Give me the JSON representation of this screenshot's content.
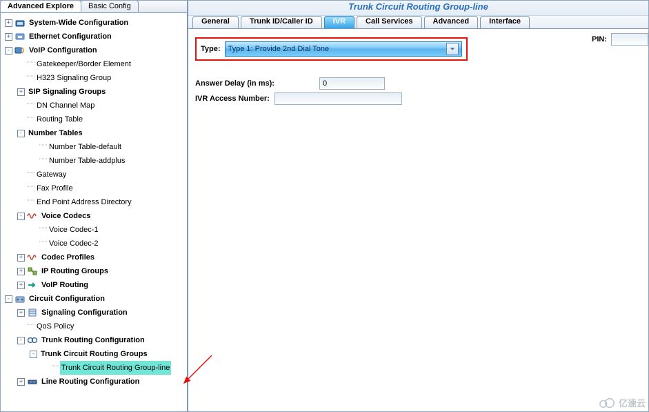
{
  "left_panel": {
    "tabs": [
      {
        "label": "Advanced Explore",
        "active": true
      },
      {
        "label": "Basic Config",
        "active": false
      }
    ]
  },
  "tree": [
    {
      "d": 0,
      "exp": "+",
      "icon": "syswide",
      "bold": true,
      "label": "System-Wide Configuration"
    },
    {
      "d": 0,
      "exp": "+",
      "icon": "eth",
      "bold": true,
      "label": "Ethernet Configuration"
    },
    {
      "d": 0,
      "exp": "-",
      "icon": "voip",
      "bold": true,
      "label": "VoIP Configuration"
    },
    {
      "d": 1,
      "exp": "",
      "icon": "",
      "bold": false,
      "label": "Gatekeeper/Border Element"
    },
    {
      "d": 1,
      "exp": "",
      "icon": "",
      "bold": false,
      "label": "H323 Signaling Group"
    },
    {
      "d": 1,
      "exp": "+",
      "icon": "",
      "bold": true,
      "label": "SIP Signaling Groups"
    },
    {
      "d": 1,
      "exp": "",
      "icon": "",
      "bold": false,
      "label": "DN Channel Map"
    },
    {
      "d": 1,
      "exp": "",
      "icon": "",
      "bold": false,
      "label": "Routing Table"
    },
    {
      "d": 1,
      "exp": "-",
      "icon": "",
      "bold": true,
      "label": "Number Tables"
    },
    {
      "d": 2,
      "exp": "",
      "icon": "",
      "bold": false,
      "label": "Number Table-default"
    },
    {
      "d": 2,
      "exp": "",
      "icon": "",
      "bold": false,
      "label": "Number Table-addplus"
    },
    {
      "d": 1,
      "exp": "",
      "icon": "",
      "bold": false,
      "label": "Gateway"
    },
    {
      "d": 1,
      "exp": "",
      "icon": "",
      "bold": false,
      "label": "Fax Profile"
    },
    {
      "d": 1,
      "exp": "",
      "icon": "",
      "bold": false,
      "label": "End Point Address Directory"
    },
    {
      "d": 1,
      "exp": "-",
      "icon": "wave",
      "bold": true,
      "label": "Voice Codecs"
    },
    {
      "d": 2,
      "exp": "",
      "icon": "",
      "bold": false,
      "label": "Voice Codec-1"
    },
    {
      "d": 2,
      "exp": "",
      "icon": "",
      "bold": false,
      "label": "Voice Codec-2"
    },
    {
      "d": 1,
      "exp": "+",
      "icon": "wave",
      "bold": true,
      "label": "Codec Profiles"
    },
    {
      "d": 1,
      "exp": "+",
      "icon": "iprg",
      "bold": true,
      "label": "IP Routing Groups"
    },
    {
      "d": 1,
      "exp": "+",
      "icon": "vroute",
      "bold": true,
      "label": "VoIP Routing"
    },
    {
      "d": 0,
      "exp": "-",
      "icon": "circuit",
      "bold": true,
      "label": "Circuit Configuration"
    },
    {
      "d": 1,
      "exp": "+",
      "icon": "sigcfg",
      "bold": true,
      "label": "Signaling Configuration"
    },
    {
      "d": 1,
      "exp": "",
      "icon": "",
      "bold": false,
      "label": "QoS Policy"
    },
    {
      "d": 1,
      "exp": "-",
      "icon": "trunk",
      "bold": true,
      "label": "Trunk Routing Configuration"
    },
    {
      "d": 2,
      "exp": "-",
      "icon": "",
      "bold": true,
      "label": "Trunk Circuit Routing Groups"
    },
    {
      "d": 3,
      "exp": "",
      "icon": "",
      "bold": false,
      "label": "Trunk Circuit Routing Group-line",
      "sel": true
    },
    {
      "d": 1,
      "exp": "+",
      "icon": "line",
      "bold": true,
      "label": "Line Routing Configuration"
    }
  ],
  "right_panel": {
    "title": "Trunk Circuit Routing Group-line",
    "tabs": [
      {
        "label": "General"
      },
      {
        "label": "Trunk ID/Caller ID"
      },
      {
        "label": "IVR",
        "active": true
      },
      {
        "label": "Call Services"
      },
      {
        "label": "Advanced"
      },
      {
        "label": "Interface"
      }
    ],
    "type_label": "Type:",
    "type_value": "Type 1: Provide 2nd Dial Tone",
    "pin_label": "PIN:",
    "pin_value": "",
    "answer_delay_label": "Answer Delay (in ms):",
    "answer_delay_value": "0",
    "ivr_access_label": "IVR Access Number:",
    "ivr_access_value": ""
  },
  "watermark": "亿速云"
}
